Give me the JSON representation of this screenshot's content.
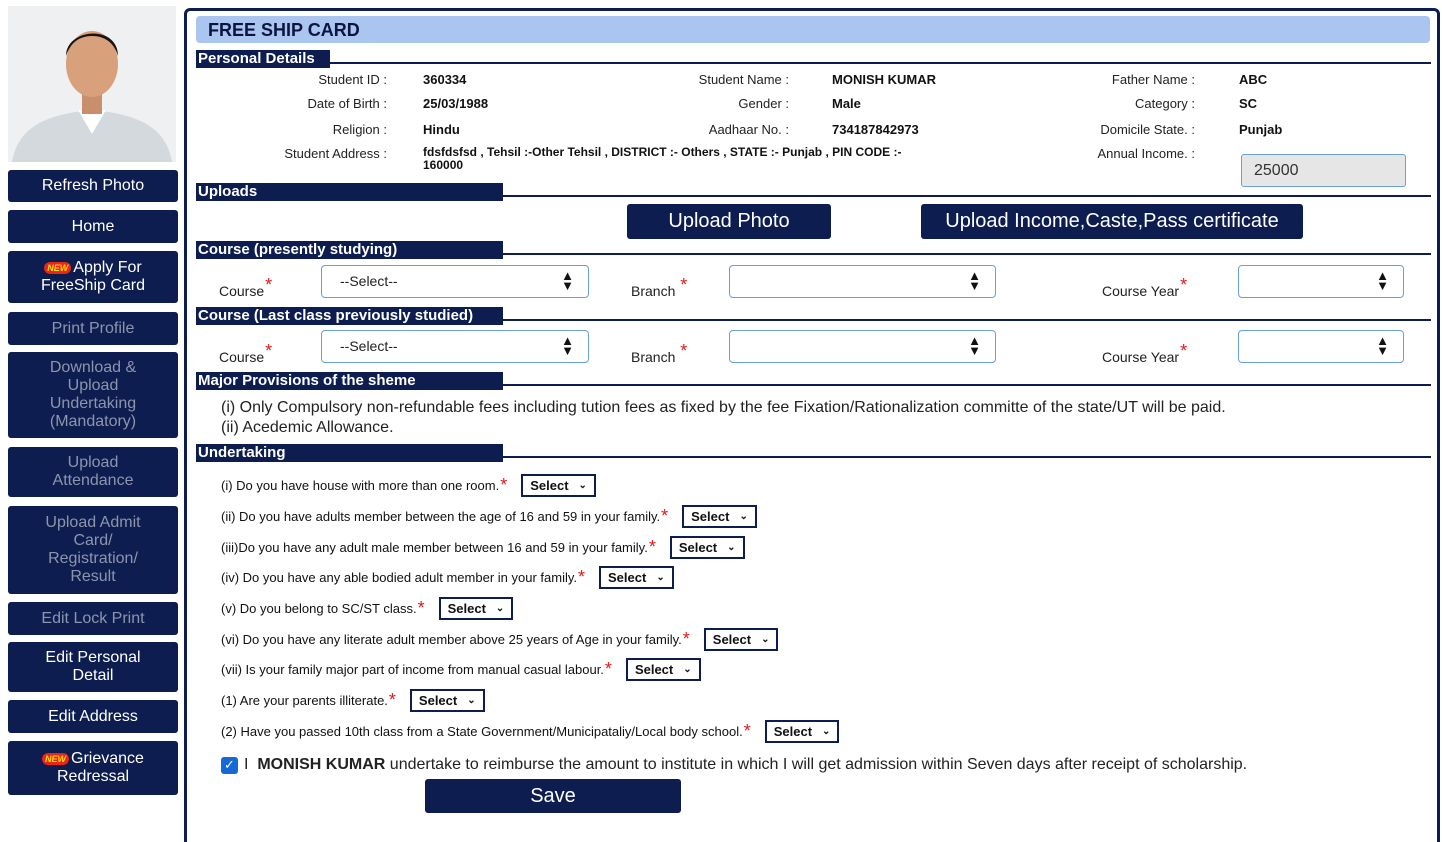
{
  "sidebar": {
    "photo_alt": "Student photo",
    "items": [
      {
        "label": "Refresh Photo"
      },
      {
        "label": "Home"
      },
      {
        "badge": "NEW",
        "label": "Apply For FreeShip Card"
      },
      {
        "label": "Print Profile"
      },
      {
        "label": "Download & Upload Undertaking (Mandatory)"
      },
      {
        "label": "Upload Attendance"
      },
      {
        "label": "Upload Admit Card/ Registration/ Result"
      },
      {
        "label": "Edit Lock Print"
      },
      {
        "label": "Edit Personal Detail"
      },
      {
        "label": "Edit Address"
      },
      {
        "badge": "NEW",
        "label": "Grievance Redressal"
      }
    ]
  },
  "title": "FREE SHIP CARD",
  "personal": {
    "heading": "Personal Details",
    "student_id_label": "Student ID :",
    "student_id": "360334",
    "student_name_label": "Student Name :",
    "student_name": "MONISH KUMAR",
    "father_name_label": "Father Name :",
    "father_name": "ABC",
    "dob_label": "Date of Birth :",
    "dob": "25/03/1988",
    "gender_label": "Gender :",
    "gender": "Male",
    "category_label": "Category :",
    "category": "SC",
    "religion_label": "Religion :",
    "religion": "Hindu",
    "aadhaar_label": "Aadhaar No. :",
    "aadhaar": "734187842973",
    "domicile_label": "Domicile State. :",
    "domicile": "Punjab",
    "address_label": "Student Address :",
    "address_line1": "fdsfdsfsd , Tehsil :-Other Tehsil , DISTRICT :- Others , STATE :- Punjab , PIN CODE :-",
    "address_line2": "160000",
    "income_label": "Annual Income. :",
    "income": "25000"
  },
  "uploads": {
    "heading": "Uploads",
    "photo_button": "Upload Photo",
    "cert_button": "Upload Income,Caste,Pass certificate"
  },
  "course_present": {
    "heading": "Course (presently studying)",
    "course_label": "Course",
    "course_value": "--Select--",
    "branch_label": "Branch",
    "branch_value": "",
    "year_label": "Course Year",
    "year_value": ""
  },
  "course_last": {
    "heading": "Course (Last class previously studied)",
    "course_label": "Course",
    "course_value": "--Select--",
    "branch_label": "Branch",
    "branch_value": "",
    "year_label": "Course Year",
    "year_value": ""
  },
  "provisions": {
    "heading": "Major Provisions of the sheme",
    "line1": "(i) Only Compulsory non-refundable fees including tution fees as fixed by the fee Fixation/Rationalization committe of the state/UT will be paid.",
    "line2": "(ii) Acedemic Allowance."
  },
  "undertaking": {
    "heading": "Undertaking",
    "select_label": "Select",
    "questions": [
      "(i) Do you have house with more than one room.",
      "(ii) Do you have adults member between the age of 16 and 59 in your family.",
      "(iii)Do you have any adult male member between 16 and 59 in your family.",
      "(iv) Do you have any able bodied adult member in your family.",
      "(v) Do you belong to SC/ST class.",
      "(vi) Do you have any literate adult member above 25 years of Age in your family.",
      "(vii) Is your family major part of income from manual casual labour.",
      "(1) Are your parents illiterate.",
      "(2) Have you passed 10th class from a State Government/Municipataliy/Local body school."
    ],
    "statement_prefix": "I",
    "statement_name": "MONISH KUMAR",
    "statement_rest": "undertake to reimburse the amount to institute in which I will get admission within Seven days after receipt of scholarship.",
    "save_button": "Save"
  }
}
